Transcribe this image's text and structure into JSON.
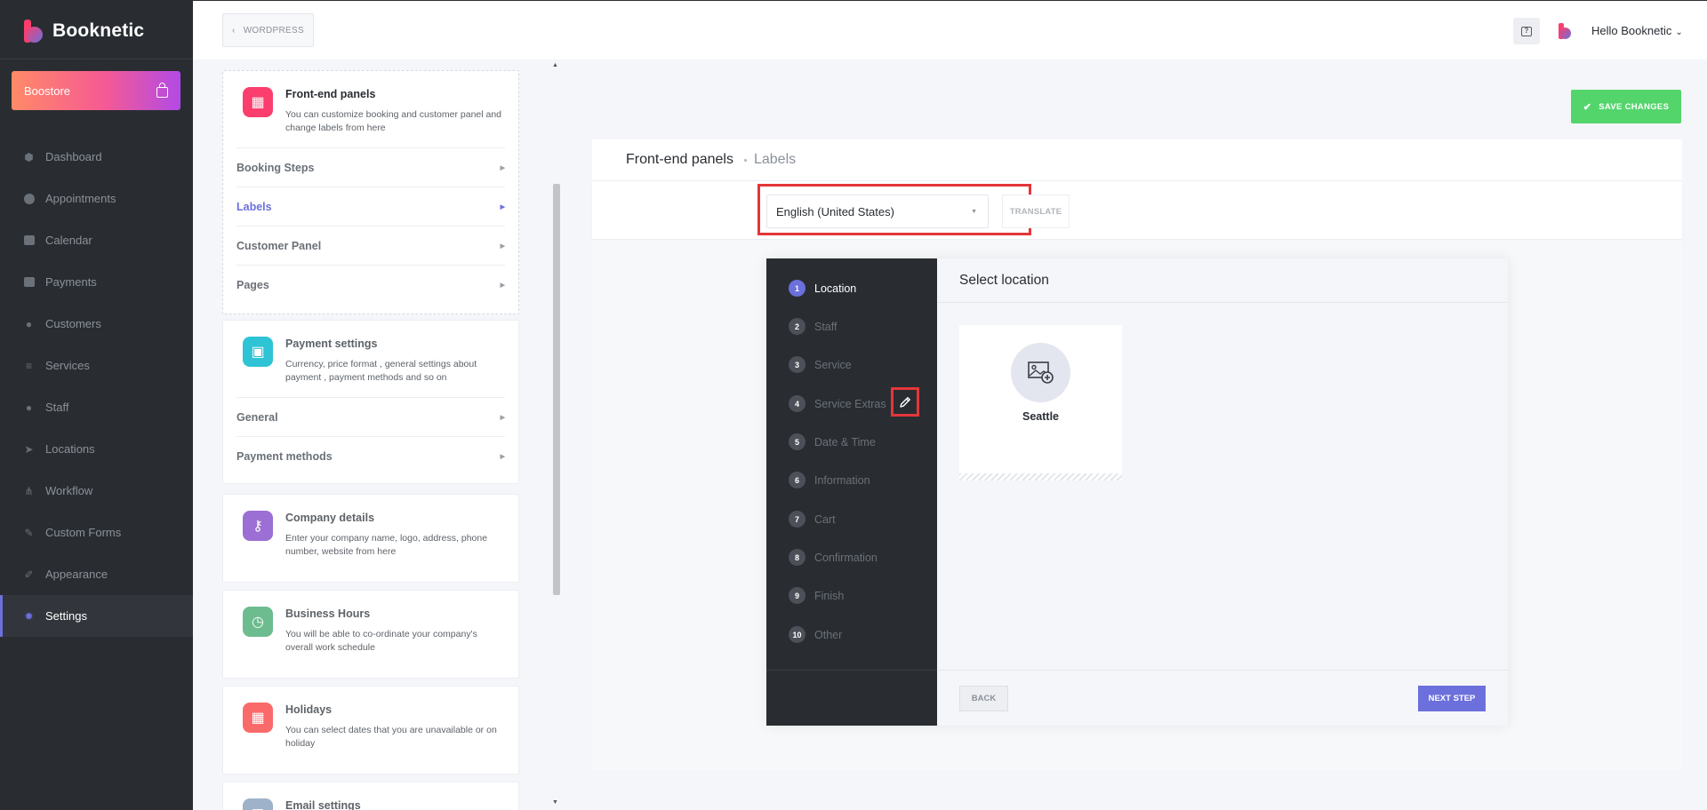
{
  "app": {
    "name": "Booknetic"
  },
  "sidebar": {
    "boostore_label": "Boostore",
    "items": [
      {
        "label": "Dashboard",
        "icon": "dashboard-icon"
      },
      {
        "label": "Appointments",
        "icon": "clock-icon"
      },
      {
        "label": "Calendar",
        "icon": "calendar-icon"
      },
      {
        "label": "Payments",
        "icon": "credit-card-icon"
      },
      {
        "label": "Customers",
        "icon": "users-icon"
      },
      {
        "label": "Services",
        "icon": "list-icon"
      },
      {
        "label": "Staff",
        "icon": "user-icon"
      },
      {
        "label": "Locations",
        "icon": "location-arrow-icon"
      },
      {
        "label": "Workflow",
        "icon": "workflow-icon"
      },
      {
        "label": "Custom Forms",
        "icon": "magic-wand-icon"
      },
      {
        "label": "Appearance",
        "icon": "brush-icon"
      },
      {
        "label": "Settings",
        "icon": "gear-icon",
        "active": true
      }
    ]
  },
  "header": {
    "wordpress_label": "WORDPRESS",
    "help_icon": "question-chat-icon",
    "user_greeting": "Hello Booknetic"
  },
  "settings": {
    "frontend": {
      "title": "Front-end panels",
      "desc": "You can customize booking and customer panel and change labels from here",
      "links": [
        "Booking Steps",
        "Labels",
        "Customer Panel",
        "Pages"
      ],
      "active_link": "Labels"
    },
    "payment": {
      "title": "Payment settings",
      "desc": "Currency, price format , general settings about payment , payment methods and so on",
      "links": [
        "General",
        "Payment methods"
      ]
    },
    "company": {
      "title": "Company details",
      "desc": "Enter your company name, logo, address, phone number, website from here"
    },
    "hours": {
      "title": "Business Hours",
      "desc": "You will be able to co-ordinate your company's overall work schedule"
    },
    "holidays": {
      "title": "Holidays",
      "desc": "You can select dates that you are unavailable or on holiday"
    },
    "email": {
      "title": "Email settings"
    }
  },
  "main": {
    "save_label": "SAVE CHANGES",
    "breadcrumb": [
      "Front-end panels",
      "Labels"
    ],
    "language": "English (United States)",
    "translate_label": "TRANSLATE"
  },
  "booking": {
    "steps": [
      {
        "num": "1",
        "label": "Location",
        "active": true
      },
      {
        "num": "2",
        "label": "Staff"
      },
      {
        "num": "3",
        "label": "Service"
      },
      {
        "num": "4",
        "label": "Service Extras"
      },
      {
        "num": "5",
        "label": "Date & Time"
      },
      {
        "num": "6",
        "label": "Information"
      },
      {
        "num": "7",
        "label": "Cart"
      },
      {
        "num": "8",
        "label": "Confirmation"
      },
      {
        "num": "9",
        "label": "Finish"
      },
      {
        "num": "10",
        "label": "Other"
      }
    ],
    "title": "Select location",
    "location_name": "Seattle",
    "back_label": "BACK",
    "next_label": "NEXT STEP"
  },
  "colors": {
    "accent": "#6c70dc",
    "save_green": "#53d56c",
    "highlight_red": "#e4363a",
    "sidebar_bg": "#292d32"
  }
}
